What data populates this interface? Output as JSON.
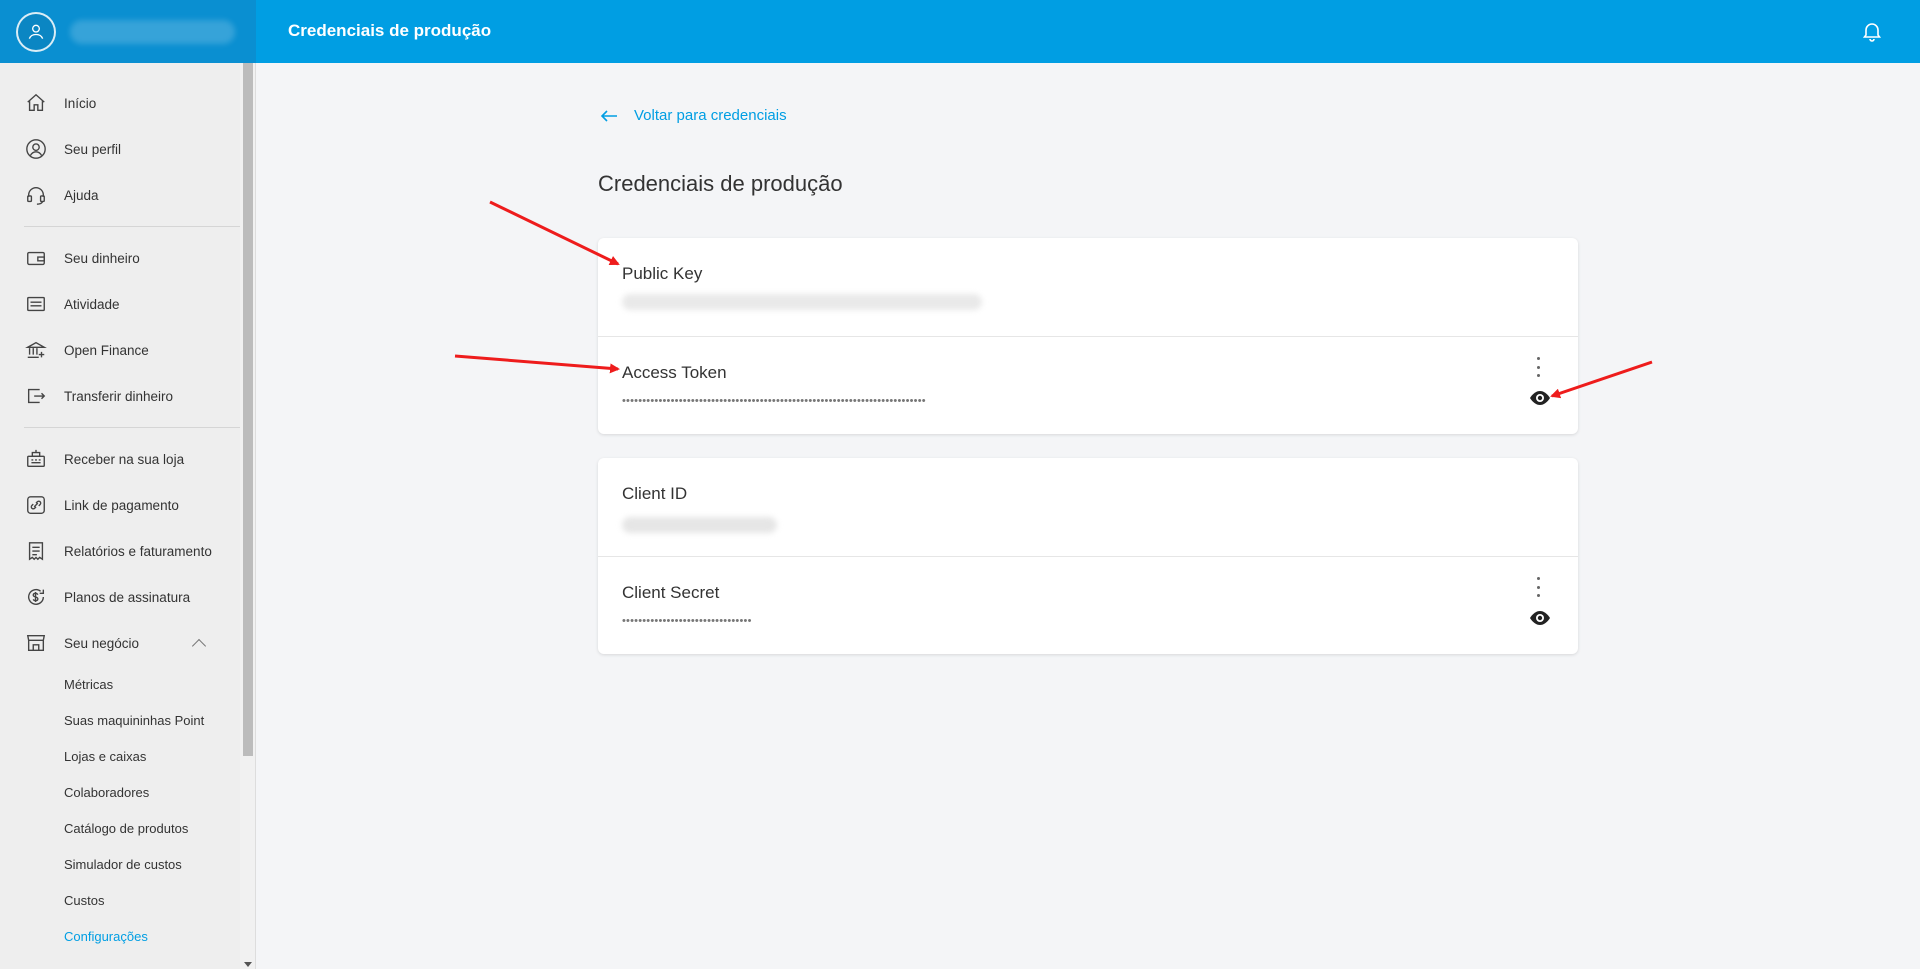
{
  "header": {
    "title": "Credenciais de produção"
  },
  "sidebar": {
    "items": [
      {
        "label": "Início",
        "icon": "home-icon"
      },
      {
        "label": "Seu perfil",
        "icon": "profile-icon"
      },
      {
        "label": "Ajuda",
        "icon": "headset-icon"
      },
      {
        "label": "Seu dinheiro",
        "icon": "wallet-icon"
      },
      {
        "label": "Atividade",
        "icon": "activity-icon"
      },
      {
        "label": "Open Finance",
        "icon": "bank-icon"
      },
      {
        "label": "Transferir dinheiro",
        "icon": "transfer-icon"
      },
      {
        "label": "Receber na sua loja",
        "icon": "register-icon"
      },
      {
        "label": "Link de pagamento",
        "icon": "link-icon"
      },
      {
        "label": "Relatórios e faturamento",
        "icon": "receipt-icon"
      },
      {
        "label": "Planos de assinatura",
        "icon": "subscription-icon"
      },
      {
        "label": "Seu negócio",
        "icon": "store-icon"
      }
    ],
    "business_submenu": [
      "Métricas",
      "Suas maquininhas Point",
      "Lojas e caixas",
      "Colaboradores",
      "Catálogo de produtos",
      "Simulador de custos",
      "Custos",
      "Configurações"
    ],
    "active_subitem": "Configurações"
  },
  "main": {
    "back_label": "Voltar para credenciais",
    "title": "Credenciais de produção",
    "cards": [
      {
        "rows": [
          {
            "label": "Public Key",
            "value_state": "blurred"
          },
          {
            "label": "Access Token",
            "masked_value": "•••••••••••••••••••••••••••••••••••••••••••••••••••••••••••••••••••••••••••"
          }
        ]
      },
      {
        "rows": [
          {
            "label": "Client ID",
            "value_state": "blurred"
          },
          {
            "label": "Client Secret",
            "masked_value": "••••••••••••••••••••••••••••••••"
          }
        ]
      }
    ]
  },
  "colors": {
    "brand": "#009ee3",
    "annotation": "#ee1c1c"
  }
}
